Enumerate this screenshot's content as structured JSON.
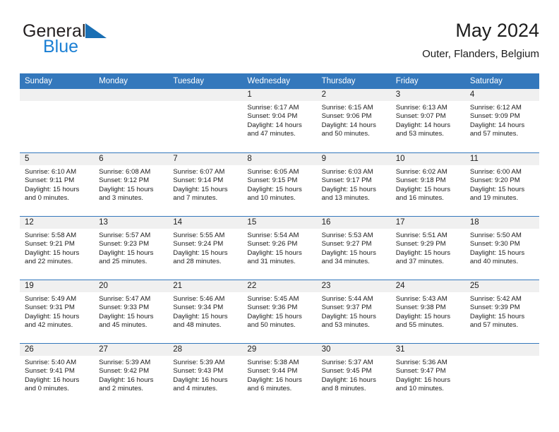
{
  "brand": {
    "name_part1": "General",
    "name_part2": "Blue",
    "triangle_color": "#1a6fb4",
    "blue_color": "#1a7fd4"
  },
  "header": {
    "title": "May 2024",
    "subtitle": "Outer, Flanders, Belgium"
  },
  "theme": {
    "header_blue": "#3478bc",
    "date_band_gray": "#f0f0f0",
    "text_color": "#1c1c1c"
  },
  "weekdays": [
    "Sunday",
    "Monday",
    "Tuesday",
    "Wednesday",
    "Thursday",
    "Friday",
    "Saturday"
  ],
  "weeks": [
    [
      {
        "date": "",
        "sunrise": "",
        "sunset": "",
        "daylight_line1": "",
        "daylight_line2": ""
      },
      {
        "date": "",
        "sunrise": "",
        "sunset": "",
        "daylight_line1": "",
        "daylight_line2": ""
      },
      {
        "date": "",
        "sunrise": "",
        "sunset": "",
        "daylight_line1": "",
        "daylight_line2": ""
      },
      {
        "date": "1",
        "sunrise": "Sunrise: 6:17 AM",
        "sunset": "Sunset: 9:04 PM",
        "daylight_line1": "Daylight: 14 hours",
        "daylight_line2": "and 47 minutes."
      },
      {
        "date": "2",
        "sunrise": "Sunrise: 6:15 AM",
        "sunset": "Sunset: 9:06 PM",
        "daylight_line1": "Daylight: 14 hours",
        "daylight_line2": "and 50 minutes."
      },
      {
        "date": "3",
        "sunrise": "Sunrise: 6:13 AM",
        "sunset": "Sunset: 9:07 PM",
        "daylight_line1": "Daylight: 14 hours",
        "daylight_line2": "and 53 minutes."
      },
      {
        "date": "4",
        "sunrise": "Sunrise: 6:12 AM",
        "sunset": "Sunset: 9:09 PM",
        "daylight_line1": "Daylight: 14 hours",
        "daylight_line2": "and 57 minutes."
      }
    ],
    [
      {
        "date": "5",
        "sunrise": "Sunrise: 6:10 AM",
        "sunset": "Sunset: 9:11 PM",
        "daylight_line1": "Daylight: 15 hours",
        "daylight_line2": "and 0 minutes."
      },
      {
        "date": "6",
        "sunrise": "Sunrise: 6:08 AM",
        "sunset": "Sunset: 9:12 PM",
        "daylight_line1": "Daylight: 15 hours",
        "daylight_line2": "and 3 minutes."
      },
      {
        "date": "7",
        "sunrise": "Sunrise: 6:07 AM",
        "sunset": "Sunset: 9:14 PM",
        "daylight_line1": "Daylight: 15 hours",
        "daylight_line2": "and 7 minutes."
      },
      {
        "date": "8",
        "sunrise": "Sunrise: 6:05 AM",
        "sunset": "Sunset: 9:15 PM",
        "daylight_line1": "Daylight: 15 hours",
        "daylight_line2": "and 10 minutes."
      },
      {
        "date": "9",
        "sunrise": "Sunrise: 6:03 AM",
        "sunset": "Sunset: 9:17 PM",
        "daylight_line1": "Daylight: 15 hours",
        "daylight_line2": "and 13 minutes."
      },
      {
        "date": "10",
        "sunrise": "Sunrise: 6:02 AM",
        "sunset": "Sunset: 9:18 PM",
        "daylight_line1": "Daylight: 15 hours",
        "daylight_line2": "and 16 minutes."
      },
      {
        "date": "11",
        "sunrise": "Sunrise: 6:00 AM",
        "sunset": "Sunset: 9:20 PM",
        "daylight_line1": "Daylight: 15 hours",
        "daylight_line2": "and 19 minutes."
      }
    ],
    [
      {
        "date": "12",
        "sunrise": "Sunrise: 5:58 AM",
        "sunset": "Sunset: 9:21 PM",
        "daylight_line1": "Daylight: 15 hours",
        "daylight_line2": "and 22 minutes."
      },
      {
        "date": "13",
        "sunrise": "Sunrise: 5:57 AM",
        "sunset": "Sunset: 9:23 PM",
        "daylight_line1": "Daylight: 15 hours",
        "daylight_line2": "and 25 minutes."
      },
      {
        "date": "14",
        "sunrise": "Sunrise: 5:55 AM",
        "sunset": "Sunset: 9:24 PM",
        "daylight_line1": "Daylight: 15 hours",
        "daylight_line2": "and 28 minutes."
      },
      {
        "date": "15",
        "sunrise": "Sunrise: 5:54 AM",
        "sunset": "Sunset: 9:26 PM",
        "daylight_line1": "Daylight: 15 hours",
        "daylight_line2": "and 31 minutes."
      },
      {
        "date": "16",
        "sunrise": "Sunrise: 5:53 AM",
        "sunset": "Sunset: 9:27 PM",
        "daylight_line1": "Daylight: 15 hours",
        "daylight_line2": "and 34 minutes."
      },
      {
        "date": "17",
        "sunrise": "Sunrise: 5:51 AM",
        "sunset": "Sunset: 9:29 PM",
        "daylight_line1": "Daylight: 15 hours",
        "daylight_line2": "and 37 minutes."
      },
      {
        "date": "18",
        "sunrise": "Sunrise: 5:50 AM",
        "sunset": "Sunset: 9:30 PM",
        "daylight_line1": "Daylight: 15 hours",
        "daylight_line2": "and 40 minutes."
      }
    ],
    [
      {
        "date": "19",
        "sunrise": "Sunrise: 5:49 AM",
        "sunset": "Sunset: 9:31 PM",
        "daylight_line1": "Daylight: 15 hours",
        "daylight_line2": "and 42 minutes."
      },
      {
        "date": "20",
        "sunrise": "Sunrise: 5:47 AM",
        "sunset": "Sunset: 9:33 PM",
        "daylight_line1": "Daylight: 15 hours",
        "daylight_line2": "and 45 minutes."
      },
      {
        "date": "21",
        "sunrise": "Sunrise: 5:46 AM",
        "sunset": "Sunset: 9:34 PM",
        "daylight_line1": "Daylight: 15 hours",
        "daylight_line2": "and 48 minutes."
      },
      {
        "date": "22",
        "sunrise": "Sunrise: 5:45 AM",
        "sunset": "Sunset: 9:36 PM",
        "daylight_line1": "Daylight: 15 hours",
        "daylight_line2": "and 50 minutes."
      },
      {
        "date": "23",
        "sunrise": "Sunrise: 5:44 AM",
        "sunset": "Sunset: 9:37 PM",
        "daylight_line1": "Daylight: 15 hours",
        "daylight_line2": "and 53 minutes."
      },
      {
        "date": "24",
        "sunrise": "Sunrise: 5:43 AM",
        "sunset": "Sunset: 9:38 PM",
        "daylight_line1": "Daylight: 15 hours",
        "daylight_line2": "and 55 minutes."
      },
      {
        "date": "25",
        "sunrise": "Sunrise: 5:42 AM",
        "sunset": "Sunset: 9:39 PM",
        "daylight_line1": "Daylight: 15 hours",
        "daylight_line2": "and 57 minutes."
      }
    ],
    [
      {
        "date": "26",
        "sunrise": "Sunrise: 5:40 AM",
        "sunset": "Sunset: 9:41 PM",
        "daylight_line1": "Daylight: 16 hours",
        "daylight_line2": "and 0 minutes."
      },
      {
        "date": "27",
        "sunrise": "Sunrise: 5:39 AM",
        "sunset": "Sunset: 9:42 PM",
        "daylight_line1": "Daylight: 16 hours",
        "daylight_line2": "and 2 minutes."
      },
      {
        "date": "28",
        "sunrise": "Sunrise: 5:39 AM",
        "sunset": "Sunset: 9:43 PM",
        "daylight_line1": "Daylight: 16 hours",
        "daylight_line2": "and 4 minutes."
      },
      {
        "date": "29",
        "sunrise": "Sunrise: 5:38 AM",
        "sunset": "Sunset: 9:44 PM",
        "daylight_line1": "Daylight: 16 hours",
        "daylight_line2": "and 6 minutes."
      },
      {
        "date": "30",
        "sunrise": "Sunrise: 5:37 AM",
        "sunset": "Sunset: 9:45 PM",
        "daylight_line1": "Daylight: 16 hours",
        "daylight_line2": "and 8 minutes."
      },
      {
        "date": "31",
        "sunrise": "Sunrise: 5:36 AM",
        "sunset": "Sunset: 9:47 PM",
        "daylight_line1": "Daylight: 16 hours",
        "daylight_line2": "and 10 minutes."
      },
      {
        "date": "",
        "sunrise": "",
        "sunset": "",
        "daylight_line1": "",
        "daylight_line2": ""
      }
    ]
  ]
}
